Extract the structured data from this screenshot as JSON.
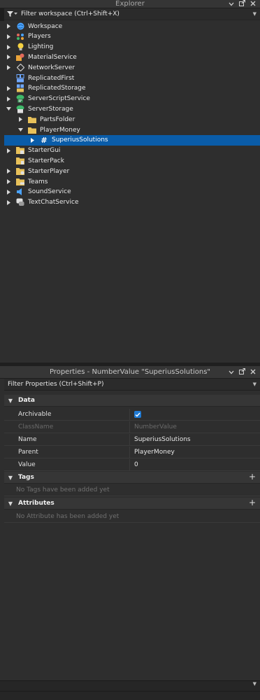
{
  "explorer": {
    "title": "Explorer",
    "filter_placeholder": "Filter workspace (Ctrl+Shift+X)",
    "items": [
      {
        "label": "Workspace",
        "chevron": "collapsed",
        "icon": "workspace-icon",
        "color": "#4aa3ff"
      },
      {
        "label": "Players",
        "chevron": "collapsed",
        "icon": "players-icon",
        "color": "#e8a33a"
      },
      {
        "label": "Lighting",
        "chevron": "collapsed",
        "icon": "lightbulb-icon",
        "color": "#f5d142"
      },
      {
        "label": "MaterialService",
        "chevron": "collapsed",
        "icon": "material-service-icon",
        "color": "#e8a33a"
      },
      {
        "label": "NetworkServer",
        "chevron": "collapsed",
        "icon": "network-server-icon",
        "color": "#cfcfcf"
      },
      {
        "label": "ReplicatedFirst",
        "chevron": "none",
        "icon": "replicated-first-icon",
        "color": "#6fa8ff"
      },
      {
        "label": "ReplicatedStorage",
        "chevron": "collapsed",
        "icon": "replicated-storage-icon",
        "color": "#6fa8ff"
      },
      {
        "label": "ServerScriptService",
        "chevron": "collapsed",
        "icon": "server-script-service-icon",
        "color": "#3fb86a"
      },
      {
        "label": "ServerStorage",
        "chevron": "expanded",
        "icon": "server-storage-icon",
        "color": "#3fb86a"
      },
      {
        "label": "PartsFolder",
        "chevron": "collapsed",
        "icon": "folder-icon",
        "color": "#e8c15a",
        "indent": 1
      },
      {
        "label": "PlayerMoney",
        "chevron": "expanded",
        "icon": "folder-icon",
        "color": "#e8c15a",
        "indent": 1
      },
      {
        "label": "SuperiusSolutions",
        "chevron": "collapsed",
        "icon": "number-value-icon",
        "color": "#ffffff",
        "indent": 2,
        "selected": true
      },
      {
        "label": "StarterGui",
        "chevron": "collapsed",
        "icon": "starter-gui-icon",
        "color": "#e8c15a"
      },
      {
        "label": "StarterPack",
        "chevron": "none",
        "icon": "starter-pack-icon",
        "color": "#e8c15a"
      },
      {
        "label": "StarterPlayer",
        "chevron": "collapsed",
        "icon": "starter-player-icon",
        "color": "#e8c15a"
      },
      {
        "label": "Teams",
        "chevron": "collapsed",
        "icon": "teams-icon",
        "color": "#e8c15a"
      },
      {
        "label": "SoundService",
        "chevron": "collapsed",
        "icon": "sound-service-icon",
        "color": "#4aa3ff"
      },
      {
        "label": "TextChatService",
        "chevron": "collapsed",
        "icon": "text-chat-service-icon",
        "color": "#e0e0e0"
      }
    ]
  },
  "properties": {
    "title": "Properties - NumberValue \"SuperiusSolutions\"",
    "filter_placeholder": "Filter Properties (Ctrl+Shift+P)",
    "sections": {
      "data": "Data",
      "tags": "Tags",
      "attributes": "Attributes"
    },
    "rows": [
      {
        "name": "Archivable",
        "value": "",
        "checkbox": true
      },
      {
        "name": "ClassName",
        "value": "NumberValue",
        "disabled": true
      },
      {
        "name": "Name",
        "value": "SuperiusSolutions"
      },
      {
        "name": "Parent",
        "value": "PlayerMoney"
      },
      {
        "name": "Value",
        "value": "0"
      }
    ],
    "tags_empty": "No Tags have been added yet",
    "attributes_empty": "No Attribute has been added yet"
  },
  "colors": {
    "selection": "#0a5ca8",
    "panel_bg": "#2e2e2e",
    "checkbox": "#1f7ad4"
  }
}
